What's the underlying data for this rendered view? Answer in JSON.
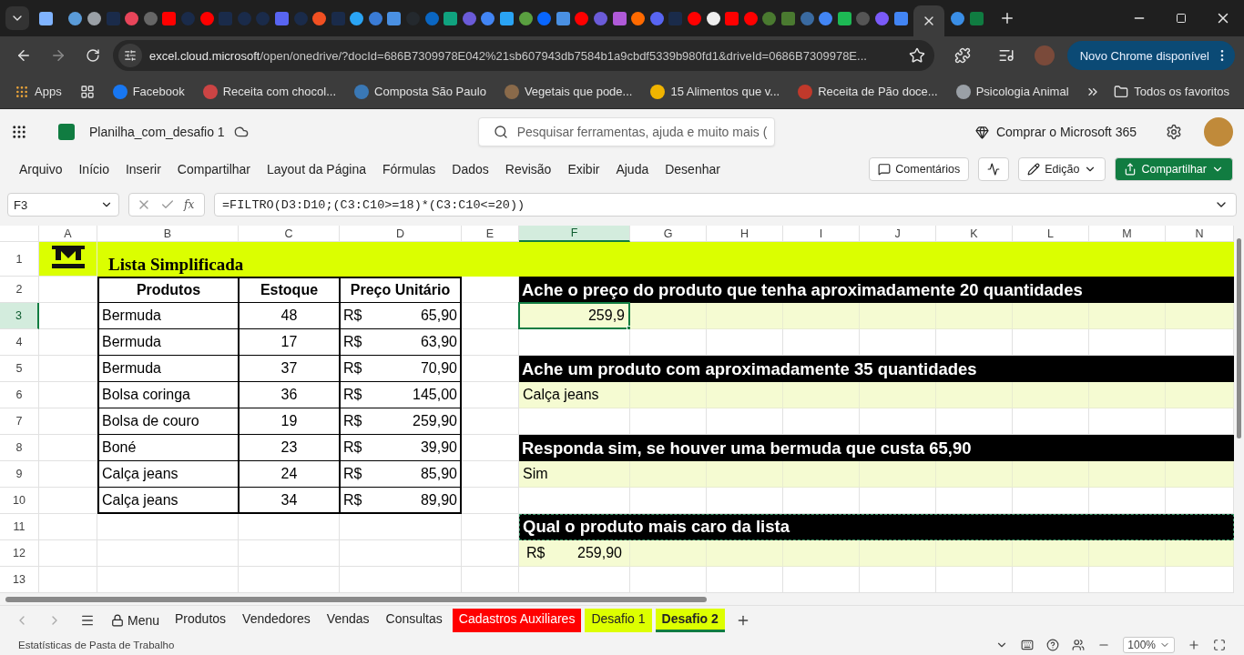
{
  "browser": {
    "tabs": [
      {
        "selected": false
      },
      {
        "selected": false
      },
      {
        "selected": false
      },
      {
        "selected": false
      },
      {
        "selected": false
      },
      {
        "selected": false
      },
      {
        "selected": false
      },
      {
        "selected": false
      },
      {
        "selected": false
      },
      {
        "selected": false
      },
      {
        "selected": false
      },
      {
        "selected": false
      },
      {
        "selected": false
      },
      {
        "selected": false
      },
      {
        "selected": false
      },
      {
        "selected": false
      },
      {
        "selected": false
      },
      {
        "selected": false
      },
      {
        "selected": false
      },
      {
        "selected": false
      },
      {
        "selected": false
      },
      {
        "selected": false
      },
      {
        "selected": false
      },
      {
        "selected": false
      },
      {
        "selected": false
      },
      {
        "selected": false
      },
      {
        "selected": false
      },
      {
        "selected": false
      },
      {
        "selected": false
      },
      {
        "selected": false
      },
      {
        "selected": false
      },
      {
        "selected": false
      },
      {
        "selected": false
      },
      {
        "selected": false
      },
      {
        "selected": false
      },
      {
        "selected": false
      },
      {
        "selected": false
      },
      {
        "selected": false
      },
      {
        "selected": false
      },
      {
        "selected": false
      },
      {
        "selected": false
      },
      {
        "selected": false
      },
      {
        "selected": false
      },
      {
        "selected": false
      },
      {
        "selected": false
      },
      {
        "selected": false
      },
      {
        "selected": true
      },
      {
        "selected": false
      },
      {
        "selected": false
      }
    ],
    "url_host": "excel.cloud.microsoft",
    "url_path": "/open/onedrive/?docId=686B7309978E042%21sb607943db7584b1a9cbdf5339b980fd1&driveId=0686B7309978E...",
    "update_button": "Novo Chrome disponível",
    "bookmarks": [
      "Apps",
      "Facebook",
      "Receita com chocol...",
      "Composta São Paulo",
      "Vegetais que pode...",
      "15 Alimentos que v...",
      "Receita de Pão doce...",
      "Psicologia Animal"
    ],
    "all_bookmarks": "Todos os favoritos"
  },
  "app": {
    "file_name": "Planilha_com_desafio 1",
    "search_placeholder": "Pesquisar ferramentas, ajuda e muito mais (",
    "buy": "Comprar o Microsoft 365",
    "menu": [
      "Arquivo",
      "Início",
      "Inserir",
      "Compartilhar",
      "Layout da Página",
      "Fórmulas",
      "Dados",
      "Revisão",
      "Exibir",
      "Ajuda",
      "Desenhar"
    ],
    "comments": "Comentários",
    "editing": "Edição",
    "share": "Compartilhar"
  },
  "formula_bar": {
    "name_box": "F3",
    "fx": "fx",
    "formula": "=FILTRO(D3:D10;(C3:C10>=18)*(C3:C10<=20))"
  },
  "grid": {
    "columns": [
      {
        "label": "A",
        "selected": false
      },
      {
        "label": "B",
        "selected": false
      },
      {
        "label": "C",
        "selected": false
      },
      {
        "label": "D",
        "selected": false
      },
      {
        "label": "E",
        "selected": false
      },
      {
        "label": "F",
        "selected": true
      },
      {
        "label": "G",
        "selected": false
      },
      {
        "label": "H",
        "selected": false
      },
      {
        "label": "I",
        "selected": false
      },
      {
        "label": "J",
        "selected": false
      },
      {
        "label": "K",
        "selected": false
      },
      {
        "label": "L",
        "selected": false
      },
      {
        "label": "M",
        "selected": false
      },
      {
        "label": "N",
        "selected": false
      }
    ],
    "rows": [
      {
        "label": "1",
        "selected": false
      },
      {
        "label": "2",
        "selected": false
      },
      {
        "label": "3",
        "selected": true
      },
      {
        "label": "4",
        "selected": false
      },
      {
        "label": "5",
        "selected": false
      },
      {
        "label": "6",
        "selected": false
      },
      {
        "label": "7",
        "selected": false
      },
      {
        "label": "8",
        "selected": false
      },
      {
        "label": "9",
        "selected": false
      },
      {
        "label": "10",
        "selected": false
      },
      {
        "label": "11",
        "selected": false
      },
      {
        "label": "12",
        "selected": false
      },
      {
        "label": "13",
        "selected": false
      }
    ],
    "title": "Lista Simplificada"
  },
  "table": {
    "headers": [
      "Produtos",
      "Estoque",
      "Preço Unitário"
    ],
    "rows": [
      {
        "product": "Bermuda",
        "stock": "48",
        "currency": "R$",
        "price": "65,90"
      },
      {
        "product": "Bermuda",
        "stock": "17",
        "currency": "R$",
        "price": "63,90"
      },
      {
        "product": "Bermuda",
        "stock": "37",
        "currency": "R$",
        "price": "70,90"
      },
      {
        "product": "Bolsa coringa",
        "stock": "36",
        "currency": "R$",
        "price": "145,00"
      },
      {
        "product": "Bolsa de couro",
        "stock": "19",
        "currency": "R$",
        "price": "259,90"
      },
      {
        "product": "Boné",
        "stock": "23",
        "currency": "R$",
        "price": "39,90"
      },
      {
        "product": "Calça jeans",
        "stock": "24",
        "currency": "R$",
        "price": "85,90"
      },
      {
        "product": "Calça jeans",
        "stock": "34",
        "currency": "R$",
        "price": "89,90"
      }
    ]
  },
  "questions": [
    {
      "question": "Ache o preço do produto que tenha aproximadamente 20 quantidades",
      "copy_marquee": false,
      "answer": {
        "kind": "number",
        "values": [
          "259,9"
        ],
        "selected": true
      }
    },
    {
      "question": "Ache um produto com aproximadamente 35 quantidades",
      "copy_marquee": false,
      "answer": {
        "kind": "text",
        "values": [
          "Calça jeans"
        ],
        "selected": false
      }
    },
    {
      "question": "Responda sim, se houver uma bermuda que custa 65,90",
      "copy_marquee": false,
      "answer": {
        "kind": "text",
        "values": [
          "Sim"
        ],
        "selected": false
      }
    },
    {
      "question": "Qual o produto mais caro da lista",
      "copy_marquee": true,
      "answer": {
        "kind": "currency",
        "values": [
          "R$",
          "259,90"
        ],
        "selected": false
      }
    }
  ],
  "sheets": {
    "menu": "Menu",
    "tabs": [
      {
        "label": "Produtos",
        "selected": false
      },
      {
        "label": "Vendedores",
        "selected": false
      },
      {
        "label": "Vendas",
        "selected": false
      },
      {
        "label": "Consultas",
        "selected": false
      },
      {
        "label": "Cadastros Auxiliares",
        "selected": false,
        "color": "#ff0000"
      },
      {
        "label": "Desafio 1",
        "selected": false,
        "color": "#ddff00"
      },
      {
        "label": "Desafio 2",
        "selected": true,
        "color": "#ddff00"
      }
    ]
  },
  "status": {
    "text": "Estatísticas de Pasta de Trabalho",
    "zoom": "100%"
  }
}
